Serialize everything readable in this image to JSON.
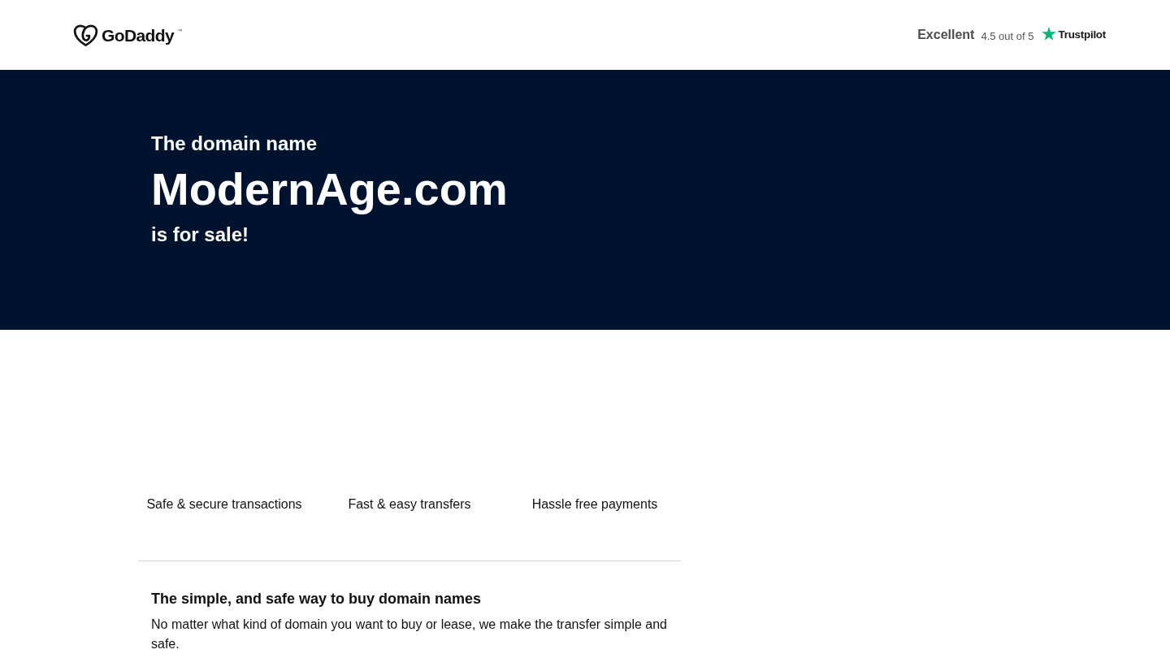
{
  "header": {
    "logo": {
      "text": "GoDaddy",
      "mark": "™"
    },
    "rating": {
      "label": "Excellent",
      "score": "4.5 out of 5",
      "brand": "Trustpilot"
    }
  },
  "hero": {
    "intro": "The domain name",
    "domain": "ModernAge.com",
    "outro": "is for sale!"
  },
  "features": [
    "Safe & secure transactions",
    "Fast & easy transfers",
    "Hassle free payments"
  ],
  "info": {
    "title": "The simple, and safe way to buy domain names",
    "text": "No matter what kind of domain you want to buy or lease, we make the transfer simple and safe."
  }
}
